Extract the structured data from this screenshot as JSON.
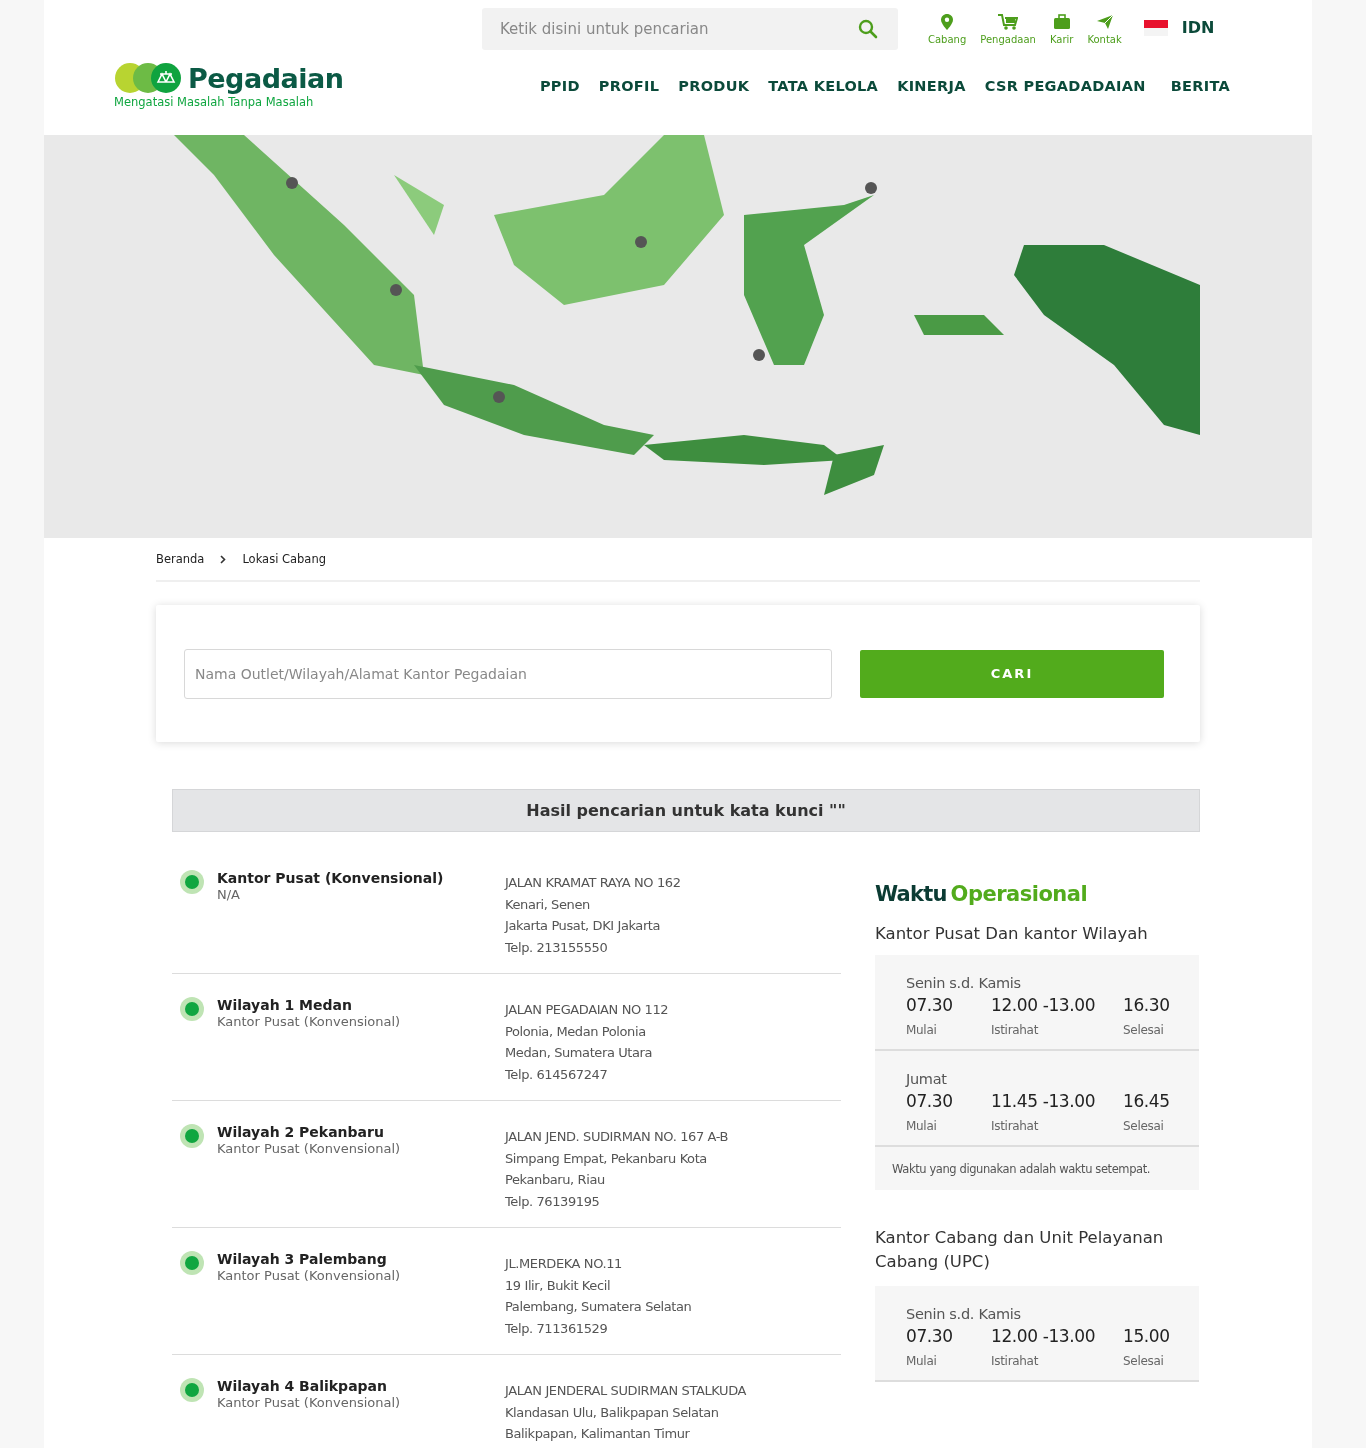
{
  "header": {
    "search": {
      "placeholder": "Ketik disini untuk pencarian"
    },
    "quick_links": [
      {
        "kind": "pin",
        "label": "Cabang"
      },
      {
        "kind": "cart",
        "label": "Pengadaan"
      },
      {
        "kind": "bag",
        "label": "Karir"
      },
      {
        "kind": "send",
        "label": "Kontak"
      }
    ],
    "language": "IDN",
    "logo": {
      "name": "Pegadaian",
      "tagline": "Mengatasi Masalah Tanpa Masalah"
    },
    "nav": [
      "PPID",
      "PROFIL",
      "PRODUK",
      "TATA KELOLA",
      "KINERJA",
      "CSR PEGADADAIAN",
      "BERITA"
    ]
  },
  "banner": {
    "kind": "picture"
  },
  "breadcrumb": [
    "Beranda",
    "Lokasi Cabang"
  ],
  "search_form": {
    "placeholder": "Nama Outlet/Wilayah/Alamat Kantor Pegadaian",
    "button": "CARI"
  },
  "results_heading": "Hasil pencarian untuk kata kunci \"\"",
  "locations": [
    {
      "name": "Kantor Pusat (Konvensional)",
      "type": "N/A",
      "address": [
        "JALAN KRAMAT RAYA NO 162",
        "Kenari, Senen",
        "Jakarta Pusat, DKI Jakarta",
        "Telp. 213155550"
      ]
    },
    {
      "name": "Wilayah 1 Medan",
      "type": "Kantor Pusat (Konvensional)",
      "address": [
        "JALAN PEGADAIAN NO 112",
        "Polonia, Medan Polonia",
        "Medan, Sumatera Utara",
        "Telp. 614567247"
      ]
    },
    {
      "name": "Wilayah 2 Pekanbaru",
      "type": "Kantor Pusat (Konvensional)",
      "address": [
        "JALAN JEND. SUDIRMAN NO. 167 A-B",
        "Simpang Empat, Pekanbaru Kota",
        "Pekanbaru, Riau",
        "Telp. 76139195"
      ]
    },
    {
      "name": "Wilayah 3 Palembang",
      "type": "Kantor Pusat (Konvensional)",
      "address": [
        "JL.MERDEKA NO.11",
        "19 Ilir, Bukit Kecil",
        "Palembang, Sumatera Selatan",
        "Telp. 711361529"
      ]
    },
    {
      "name": "Wilayah 4 Balikpapan",
      "type": "Kantor Pusat (Konvensional)",
      "address": [
        "JALAN JENDERAL SUDIRMAN STALKUDA",
        "Klandasan Ulu, Balikpapan Selatan",
        "Balikpapan, Kalimantan Timur"
      ]
    }
  ],
  "hours": {
    "title_first": "Waktu",
    "title_second": "Operasional",
    "sections": [
      {
        "title": "Kantor Pusat Dan kantor Wilayah",
        "schedules": [
          {
            "days": "Senin s.d. Kamis",
            "start": "07.30",
            "break": "12.00 -13.00",
            "end": "16.30",
            "start_label": "Mulai",
            "break_label": "Istirahat",
            "end_label": "Selesai"
          },
          {
            "days": "Jumat",
            "start": "07.30",
            "break": "11.45 -13.00",
            "end": "16.45",
            "start_label": "Mulai",
            "break_label": "Istirahat",
            "end_label": "Selesai"
          }
        ],
        "note": "Waktu yang digunakan adalah waktu setempat."
      },
      {
        "title": "Kantor Cabang dan Unit Pelayanan Cabang (UPC)",
        "schedules": [
          {
            "days": "Senin s.d. Kamis",
            "start": "07.30",
            "break": "12.00 -13.00",
            "end": "15.00",
            "start_label": "Mulai",
            "break_label": "Istirahat",
            "end_label": "Selesai"
          }
        ]
      }
    ]
  }
}
